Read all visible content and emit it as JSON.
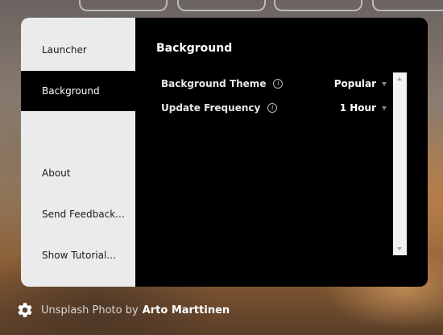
{
  "sidebar": {
    "items": [
      {
        "label": "Launcher"
      },
      {
        "label": "Background"
      },
      {
        "label": "About"
      },
      {
        "label": "Send Feedback..."
      },
      {
        "label": "Show Tutorial..."
      }
    ],
    "active": "Background"
  },
  "content": {
    "title": "Background",
    "settings": [
      {
        "label": "Background Theme",
        "value": "Popular"
      },
      {
        "label": "Update Frequency",
        "value": "1 Hour"
      }
    ]
  },
  "footer": {
    "credit_prefix": "Unsplash Photo by",
    "author": "Arto Marttinen",
    "icon": "gear-icon"
  }
}
